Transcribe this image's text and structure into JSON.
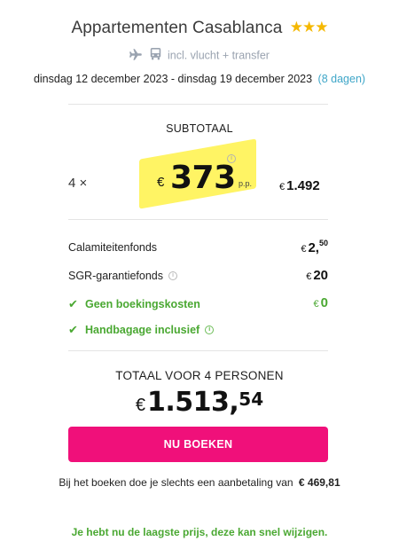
{
  "hotel": {
    "name": "Appartementen Casablanca",
    "stars": "★★★",
    "transport": "incl. vlucht + transfer"
  },
  "dates": {
    "range": "dinsdag 12 december 2023 - dinsdag 19 december 2023",
    "days": "(8 dagen)"
  },
  "subtotal": {
    "label": "SUBTOTAAL",
    "quantity": "4 ×",
    "price_currency": "€",
    "price_per_person": "373",
    "per_person_suffix": "p.p.",
    "info": "i",
    "total_currency": "€",
    "total": "1.492"
  },
  "costs": [
    {
      "label": "Calamiteitenfonds",
      "currency": "€",
      "value": "2,",
      "cents": "50"
    },
    {
      "label": "SGR-garantiefonds",
      "info": "i",
      "currency": "€",
      "value": "20"
    },
    {
      "check": "✔",
      "label": "Geen boekingskosten",
      "currency": "€",
      "value": "0"
    },
    {
      "check": "✔",
      "label": "Handbagage inclusief",
      "info": "i"
    }
  ],
  "total": {
    "label": "TOTAAL VOOR 4 PERSONEN",
    "currency": "€",
    "value": "1.513,",
    "cents": "54"
  },
  "book_button": "NU BOEKEN",
  "deposit": {
    "text": "Bij het boeken doe je slechts een aanbetaling van",
    "amount": "€ 469,81"
  },
  "notice": "Je hebt nu de laagste prijs, deze kan snel wijzigen.",
  "colors": {
    "accent_pink": "#f0107a",
    "success_green": "#4aa832",
    "link_blue": "#3ea6c8",
    "star_yellow": "#f5b800",
    "highlight_yellow": "#fff028"
  }
}
